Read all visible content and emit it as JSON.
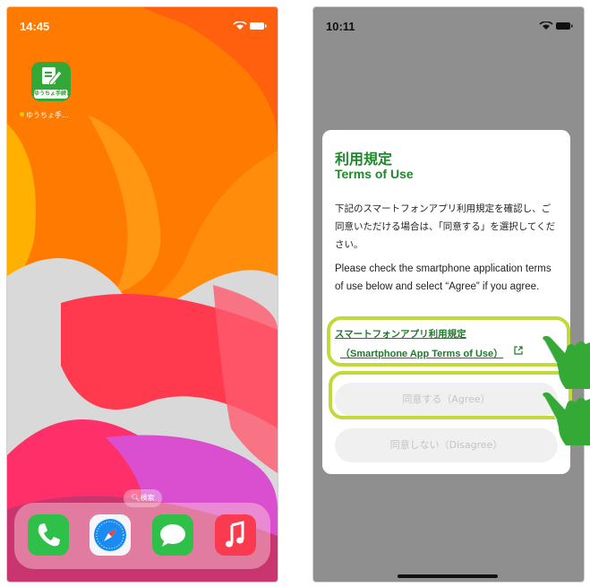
{
  "left_phone": {
    "time": "14:45",
    "app": {
      "icon_label": "ゆうちょ手続き",
      "name": "ゆうちょ手…"
    },
    "search_label": "検索",
    "dock": [
      "phone-icon",
      "safari-icon",
      "messages-icon",
      "music-icon"
    ]
  },
  "right_phone": {
    "time": "10:11",
    "dialog": {
      "title": "利用規定",
      "subtitle": "Terms of Use",
      "body_jp": "下記のスマートフォンアプリ利用規定を確認し、ご同意いただける場合は、「同意する」を選択してください。",
      "body_en": "Please check the smartphone application terms of use below and select “Agree” if you agree.",
      "link_jp": "スマートフォンアプリ利用規定",
      "link_en": "（Smartphone App Terms of Use）",
      "agree_label": "同意する（Agree）",
      "disagree_label": "同意しない（Disagree）"
    }
  },
  "colors": {
    "accent_green": "#1e8a2a",
    "highlight": "#c3d83a",
    "hand_green": "#34a936"
  }
}
